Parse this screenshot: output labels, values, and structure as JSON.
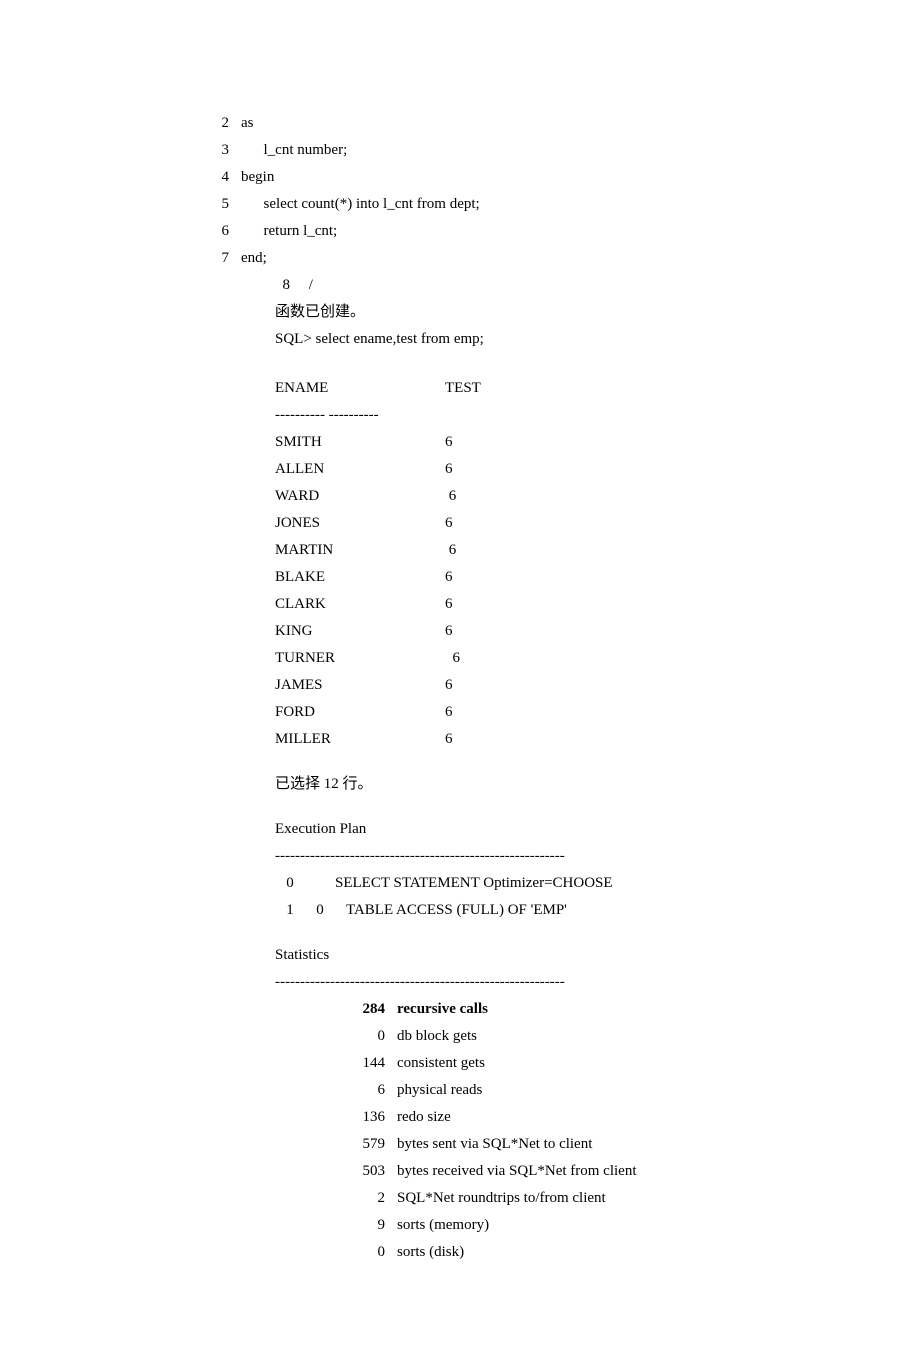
{
  "code_lines": [
    {
      "n": "2",
      "t": "as"
    },
    {
      "n": "3",
      "t": "      l_cnt number;"
    },
    {
      "n": "4",
      "t": "begin"
    },
    {
      "n": "5",
      "t": "      select count(*) into l_cnt from dept;"
    },
    {
      "n": "6",
      "t": "      return l_cnt;"
    },
    {
      "n": "7",
      "t": "end;"
    }
  ],
  "post_code": {
    "slash_line": "  8     /",
    "created_msg": "函数已创建。",
    "sql_prompt": "SQL> select ename,test from emp;"
  },
  "table": {
    "header_ename": "ENAME",
    "header_test": "TEST",
    "divider": "---------- ----------",
    "rows": [
      {
        "ename": "SMITH",
        "test": "6"
      },
      {
        "ename": "ALLEN",
        "test": "6"
      },
      {
        "ename": "WARD",
        "test": " 6"
      },
      {
        "ename": "JONES",
        "test": "6"
      },
      {
        "ename": "MARTIN",
        "test": " 6"
      },
      {
        "ename": "BLAKE",
        "test": "6"
      },
      {
        "ename": "CLARK",
        "test": "6"
      },
      {
        "ename": "KING",
        "test": "6"
      },
      {
        "ename": "TURNER",
        "test": "  6"
      },
      {
        "ename": "JAMES",
        "test": "6"
      },
      {
        "ename": "FORD",
        "test": "6"
      },
      {
        "ename": "MILLER",
        "test": "6"
      }
    ]
  },
  "rows_selected": "已选择 12 行。",
  "exec_plan": {
    "title": "Execution Plan",
    "divider": "----------------------------------------------------------",
    "lines": [
      "   0           SELECT STATEMENT Optimizer=CHOOSE",
      "   1      0      TABLE ACCESS (FULL) OF 'EMP'"
    ]
  },
  "stats": {
    "title": "Statistics",
    "divider": "----------------------------------------------------------",
    "rows": [
      {
        "n": "284",
        "lbl": "recursive calls",
        "bold": true
      },
      {
        "n": "0",
        "lbl": "db block gets"
      },
      {
        "n": "144",
        "lbl": "consistent gets"
      },
      {
        "n": "6",
        "lbl": "physical reads"
      },
      {
        "n": "136",
        "lbl": "redo size"
      },
      {
        "n": "579",
        "lbl": "bytes sent via SQL*Net to client"
      },
      {
        "n": "503",
        "lbl": "bytes received via SQL*Net from client"
      },
      {
        "n": "2",
        "lbl": "SQL*Net roundtrips to/from client"
      },
      {
        "n": "9",
        "lbl": "sorts (memory)"
      },
      {
        "n": "0",
        "lbl": "sorts (disk)"
      }
    ]
  }
}
